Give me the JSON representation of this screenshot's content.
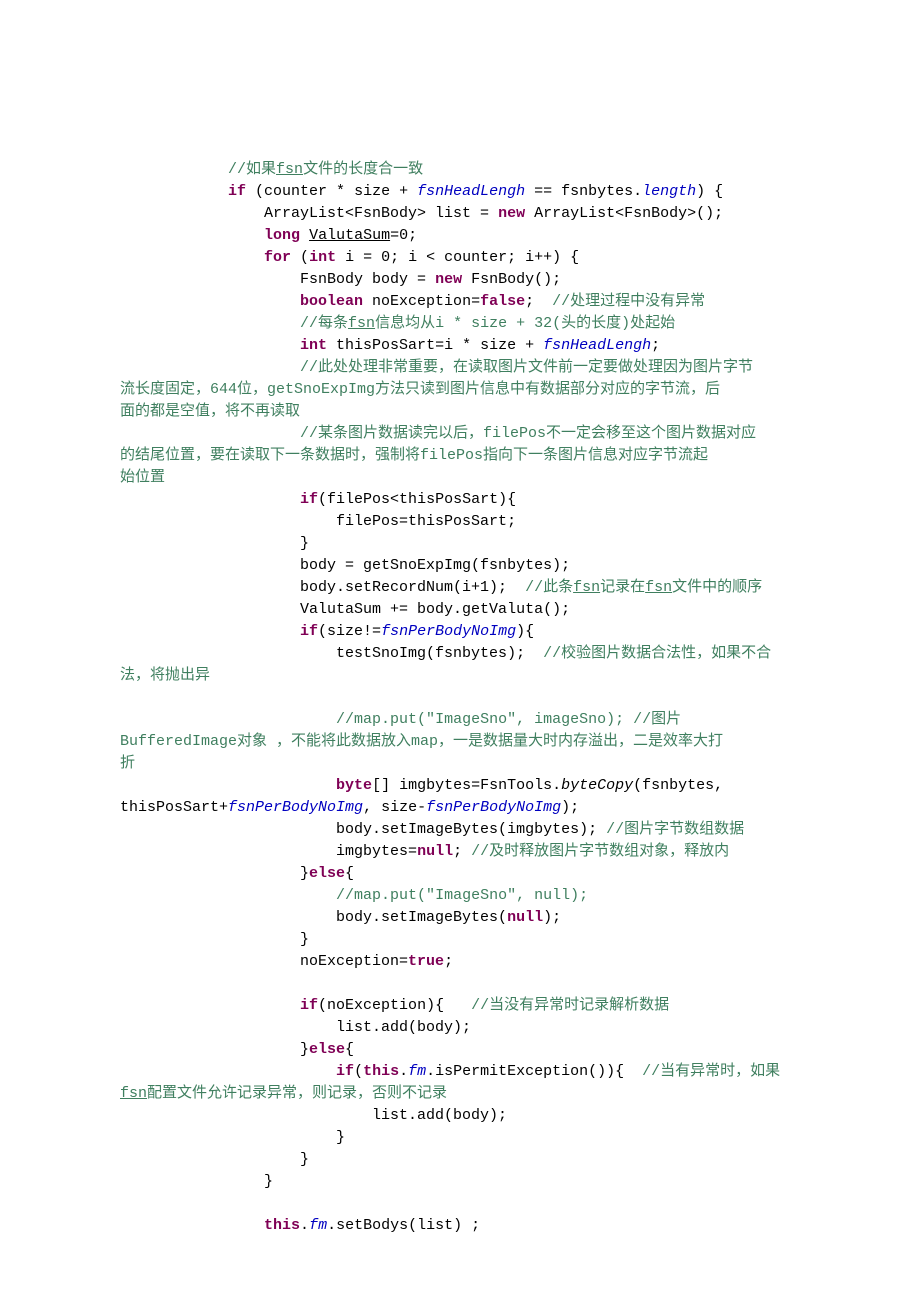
{
  "lines": {
    "l01a": "            ",
    "l01b": "//如果",
    "l01u": "fsn",
    "l01c": "文件的长度合一致",
    "l02a": "            ",
    "l02b": "if",
    "l02c": " (counter * size + ",
    "l02d": "fsnHeadLengh",
    "l02e": " == fsnbytes.",
    "l02f": "length",
    "l02g": ") {",
    "l03a": "                ArrayList<FsnBody> list = ",
    "l03b": "new",
    "l03c": " ArrayList<FsnBody>();",
    "l04a": "                ",
    "l04b": "long",
    "l04c": " ",
    "l04d": "ValutaSum",
    "l04e": "=0;",
    "l05a": "                ",
    "l05b": "for",
    "l05c": " (",
    "l05d": "int",
    "l05e": " i = 0; i < counter; i++) {",
    "l06a": "                    FsnBody body = ",
    "l06b": "new",
    "l06c": " FsnBody();",
    "l07a": "                    ",
    "l07b": "boolean",
    "l07c": " noException=",
    "l07d": "false",
    "l07e": ";  ",
    "l07f": "//处理过程中没有异常",
    "l08a": "                    ",
    "l08b": "//每条",
    "l08u": "fsn",
    "l08c": "信息均从i * size + 32(头的长度)处起始",
    "l09a": "                    ",
    "l09b": "int",
    "l09c": " thisPosSart=i * size + ",
    "l09d": "fsnHeadLengh",
    "l09e": ";",
    "l10a": "                    ",
    "l10b": "//此处处理非常重要，在读取图片文件前一定要做处理因为图片字节",
    "l11": "流长度固定，644位，getSnoExpImg方法只读到图片信息中有数据部分对应的字节流，后",
    "l12": "面的都是空值，将不再读取",
    "l13a": "                    ",
    "l13b": "//某条图片数据读完以后，filePos不一定会移至这个图片数据对应",
    "l14": "的结尾位置，要在读取下一条数据时，强制将filePos指向下一条图片信息对应字节流起",
    "l15": "始位置",
    "l16a": "                    ",
    "l16b": "if",
    "l16c": "(filePos<thisPosSart){",
    "l17": "                        filePos=thisPosSart;",
    "l18": "                    }",
    "l19": "                    body = getSnoExpImg(fsnbytes);",
    "l20a": "                    body.setRecordNum(i+1);  ",
    "l20b": "//此条",
    "l20u1": "fsn",
    "l20c": "记录在",
    "l20u2": "fsn",
    "l20d": "文件中的顺序",
    "l21": "                    ValutaSum += body.getValuta();",
    "l22a": "                    ",
    "l22b": "if",
    "l22c": "(size!=",
    "l22d": "fsnPerBodyNoImg",
    "l22e": "){",
    "l23a": "                        testSnoImg(fsnbytes);  ",
    "l23b": "//校验图片数据合法性，如果不合",
    "l24": "法，将抛出异",
    "l25": "",
    "l26a": "                        ",
    "l26b": "//map.put(\"ImageSno\", imageSno); //图片",
    "l27": "BufferedImage对象 ，不能将此数据放入map，一是数据量大时内存溢出，二是效率大打",
    "l28": "折",
    "l29a": "                        ",
    "l29b": "byte",
    "l29c": "[] imgbytes=FsnTools.",
    "l29d": "byteCopy",
    "l29e": "(fsnbytes, ",
    "l30a": "thisPosSart+",
    "l30b": "fsnPerBodyNoImg",
    "l30c": ", size-",
    "l30d": "fsnPerBodyNoImg",
    "l30e": ");",
    "l31a": "                        body.setImageBytes(imgbytes); ",
    "l31b": "//图片字节数组数据",
    "l32a": "                        imgbytes=",
    "l32b": "null",
    "l32c": "; ",
    "l32d": "//及时释放图片字节数组对象，释放内",
    "l33a": "                    }",
    "l33b": "else",
    "l33c": "{",
    "l34a": "                        ",
    "l34b": "//map.put(\"ImageSno\", null);",
    "l35a": "                        body.setImageBytes(",
    "l35b": "null",
    "l35c": ");",
    "l36": "                    }",
    "l37a": "                    noException=",
    "l37b": "true",
    "l37c": ";",
    "l38": "",
    "l39a": "                    ",
    "l39b": "if",
    "l39c": "(noException){   ",
    "l39d": "//当没有异常时记录解析数据",
    "l40": "                        list.add(body);",
    "l41a": "                    }",
    "l41b": "else",
    "l41c": "{",
    "l42a": "                        ",
    "l42b": "if",
    "l42c": "(",
    "l42d": "this",
    "l42e": ".",
    "l42f": "fm",
    "l42g": ".isPermitException()){  ",
    "l42h": "//当有异常时，如果",
    "l43a": "fsn",
    "l43b": "配置文件允许记录异常，则记录，否则不记录",
    "l44": "                            list.add(body);",
    "l45": "                        }",
    "l46": "                    }",
    "l47": "                }",
    "l48": "",
    "l49a": "                ",
    "l49b": "this",
    "l49c": ".",
    "l49d": "fm",
    "l49e": ".setBodys(list) ;",
    "l50": ""
  }
}
